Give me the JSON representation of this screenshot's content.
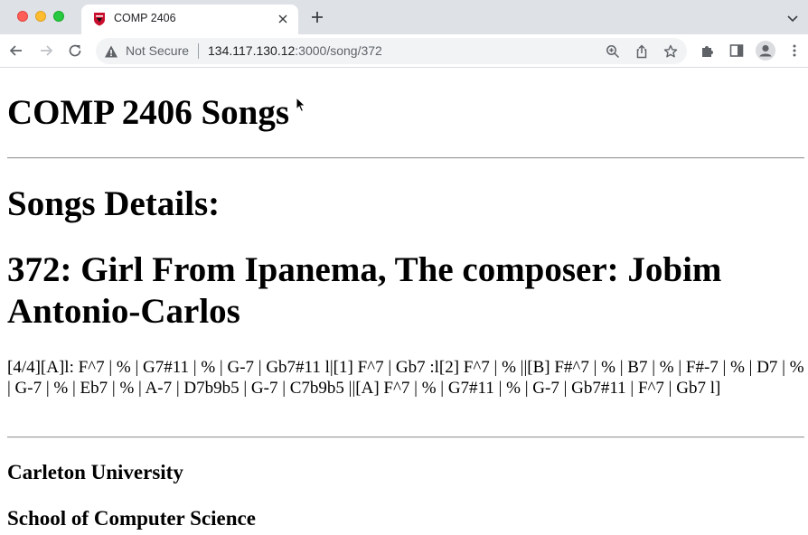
{
  "browser": {
    "tab": {
      "title": "COMP 2406"
    },
    "address_bar": {
      "security_label": "Not Secure",
      "url_host": "134.117.130.12",
      "url_path": ":3000/song/372"
    }
  },
  "page": {
    "site_title": "COMP 2406 Songs",
    "section_heading": "Songs Details:",
    "song_heading": "372: Girl From Ipanema, The composer: Jobim Antonio-Carlos",
    "chords": "[4/4][A]l: F^7 | % | G7#11 | % | G-7 | Gb7#11 l|[1] F^7 | Gb7 :l[2] F^7 | % ||[B] F#^7 | % | B7 | % | F#-7 | % | D7 | % | G-7 | % | Eb7 | % | A-7 | D7b9b5 | G-7 | C7b9b5 ||[A] F^7 | % | G7#11 | % | G-7 | Gb7#11 | F^7 | Gb7 l]",
    "footer": {
      "line1": "Carleton University",
      "line2": "School of Computer Science"
    }
  },
  "colors": {
    "tabbar_bg": "#dee1e6",
    "omnibox_bg": "#f1f3f4",
    "favicon_red": "#c8102e"
  }
}
